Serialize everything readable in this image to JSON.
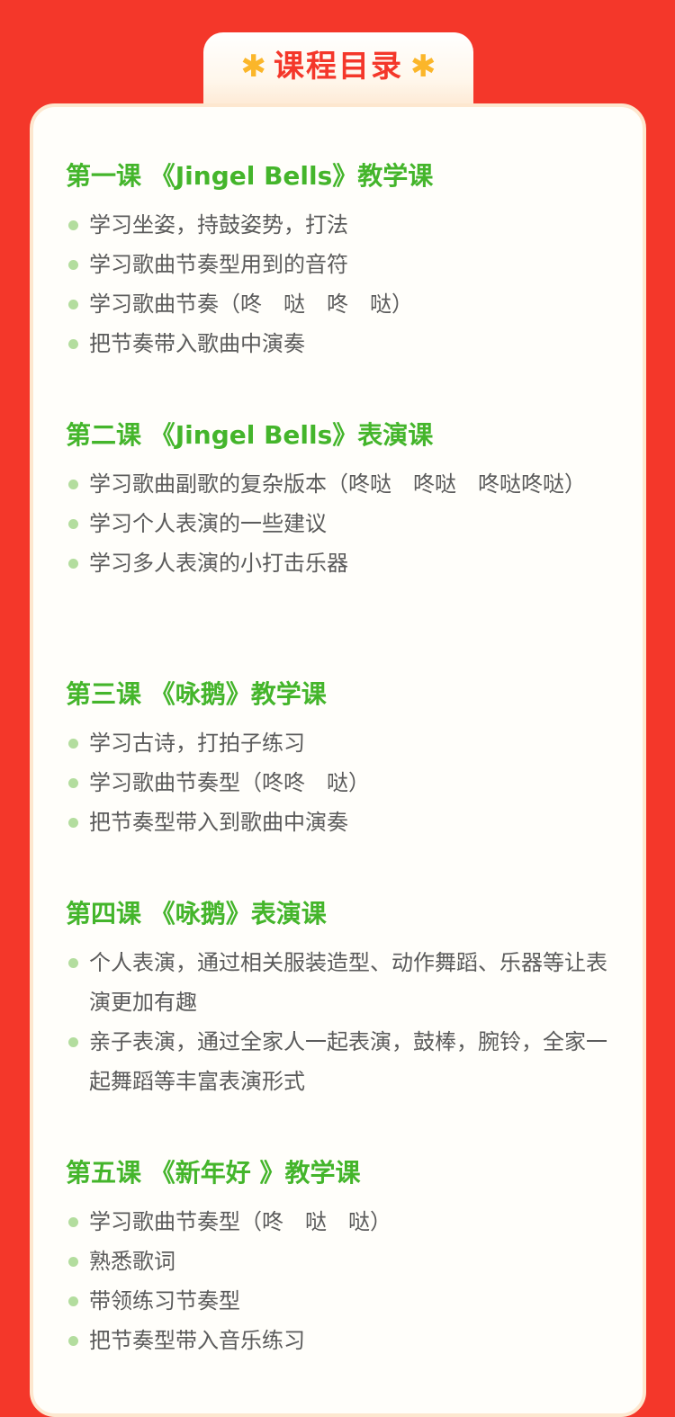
{
  "page": {
    "title": "课程目录",
    "star_glyph": "✱"
  },
  "colors": {
    "background": "#f4372a",
    "card": "#fffefa",
    "lesson_title": "#44b52b",
    "bullet": "#b3dd9e",
    "body_text": "#5b5b5b",
    "star": "#fbb62a"
  },
  "lessons": [
    {
      "title": "第一课 《Jingel Bells》教学课",
      "items": [
        "学习坐姿，持鼓姿势，打法",
        "学习歌曲节奏型用到的音符",
        "学习歌曲节奏（咚　哒　咚　哒）",
        "把节奏带入歌曲中演奏"
      ]
    },
    {
      "title": "第二课 《Jingel Bells》表演课",
      "items": [
        "学习歌曲副歌的复杂版本（咚哒　咚哒　咚哒咚哒）",
        "学习个人表演的一些建议",
        "学习多人表演的小打击乐器"
      ]
    },
    {
      "title": "第三课 《咏鹅》教学课",
      "items": [
        "学习古诗，打拍子练习",
        "学习歌曲节奏型（咚咚　哒）",
        "把节奏型带入到歌曲中演奏"
      ]
    },
    {
      "title": "第四课 《咏鹅》表演课",
      "items": [
        "个人表演，通过相关服装造型、动作舞蹈、乐器等让表演更加有趣",
        "亲子表演，通过全家人一起表演，鼓棒，腕铃，全家一起舞蹈等丰富表演形式"
      ]
    },
    {
      "title": "第五课 《新年好 》教学课",
      "items": [
        "学习歌曲节奏型（咚　哒　哒）",
        "熟悉歌词",
        "带领练习节奏型",
        "把节奏型带入音乐练习"
      ]
    }
  ]
}
